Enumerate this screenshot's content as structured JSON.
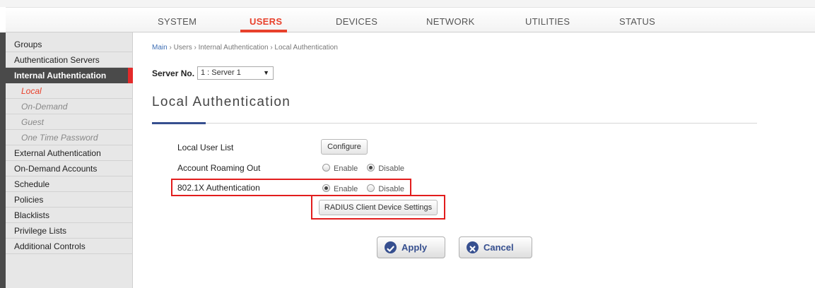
{
  "nav": {
    "items": [
      "SYSTEM",
      "USERS",
      "DEVICES",
      "NETWORK",
      "UTILITIES",
      "STATUS"
    ],
    "active": "USERS"
  },
  "sidebar": {
    "items": [
      {
        "label": "Groups"
      },
      {
        "label": "Authentication Servers"
      },
      {
        "label": "Internal Authentication",
        "active": true
      },
      {
        "label": "Local",
        "sub": true,
        "current": true
      },
      {
        "label": "On-Demand",
        "sub": true
      },
      {
        "label": "Guest",
        "sub": true
      },
      {
        "label": "One Time Password",
        "sub": true
      },
      {
        "label": "External Authentication"
      },
      {
        "label": "On-Demand Accounts"
      },
      {
        "label": "Schedule"
      },
      {
        "label": "Policies"
      },
      {
        "label": "Blacklists"
      },
      {
        "label": "Privilege Lists"
      },
      {
        "label": "Additional Controls"
      }
    ]
  },
  "breadcrumb": {
    "main": "Main",
    "rest": " › Users › Internal Authentication › Local Authentication"
  },
  "server": {
    "label": "Server No.",
    "selected": "1 : Server 1"
  },
  "page_title": "Local Authentication",
  "form": {
    "local_user_list_label": "Local User List",
    "configure_button": "Configure",
    "roaming_label": "Account Roaming Out",
    "roaming_value": "Disable",
    "dot1x_label": "802.1X Authentication",
    "dot1x_value": "Enable",
    "enable_text": "Enable",
    "disable_text": "Disable",
    "radius_button": "RADIUS Client Device Settings"
  },
  "actions": {
    "apply": "Apply",
    "cancel": "Cancel"
  },
  "colors": {
    "accent_red": "#e8412c",
    "navy": "#364f8f",
    "highlight": "#e21d1d"
  }
}
